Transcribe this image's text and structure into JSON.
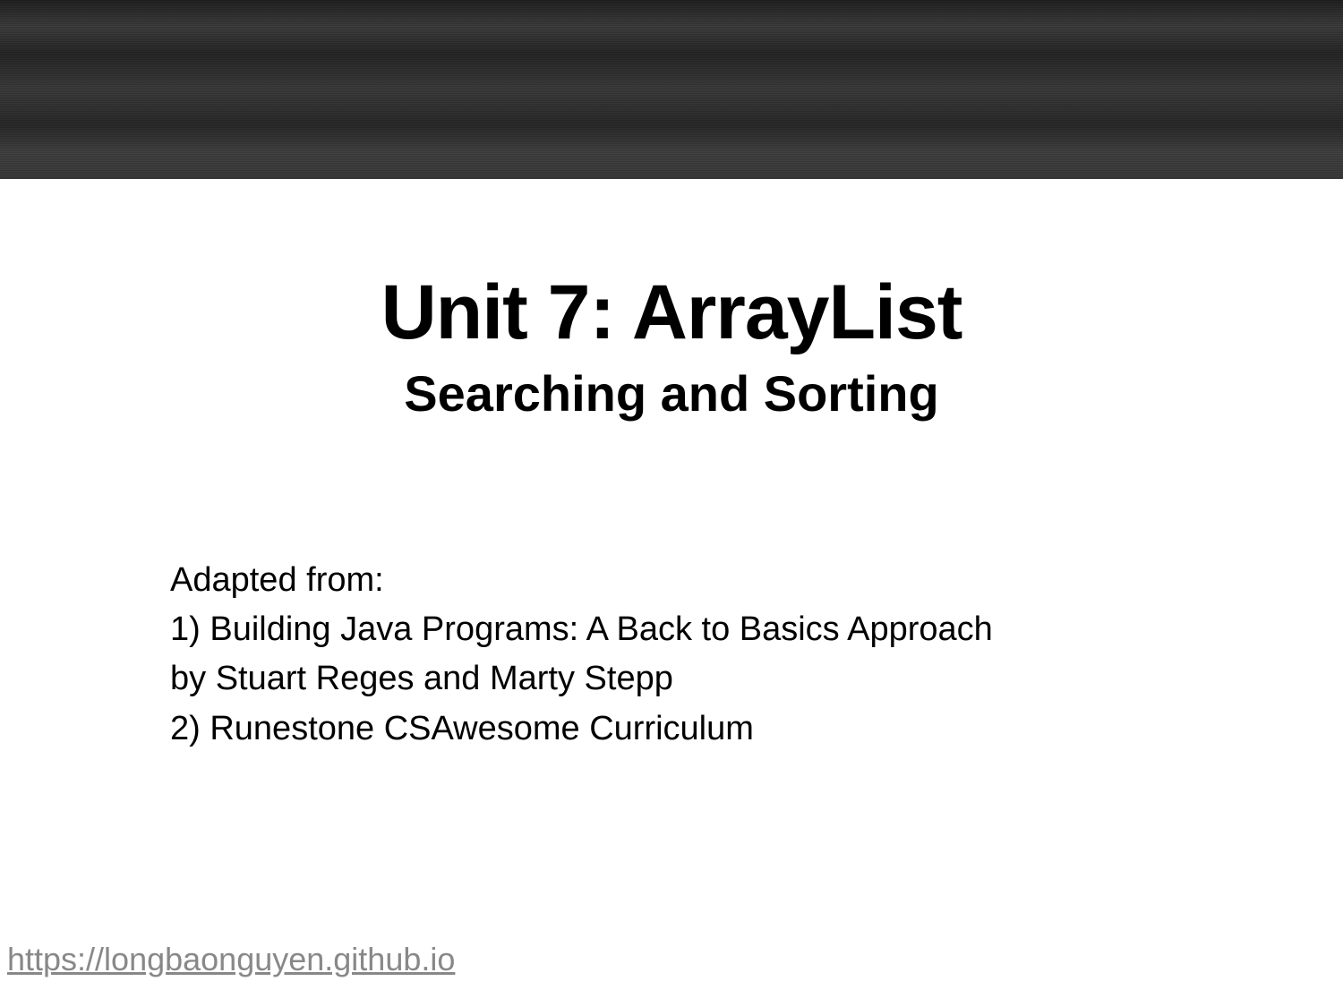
{
  "title": {
    "main": "Unit 7: ArrayList",
    "sub": "Searching and Sorting"
  },
  "body": {
    "intro": "Adapted from:",
    "line1": "1) Building Java Programs: A Back to Basics Approach",
    "line2": "by Stuart Reges and Marty Stepp",
    "line3": "2) Runestone CSAwesome Curriculum"
  },
  "footer": {
    "url": "https://longbaonguyen.github.io"
  }
}
